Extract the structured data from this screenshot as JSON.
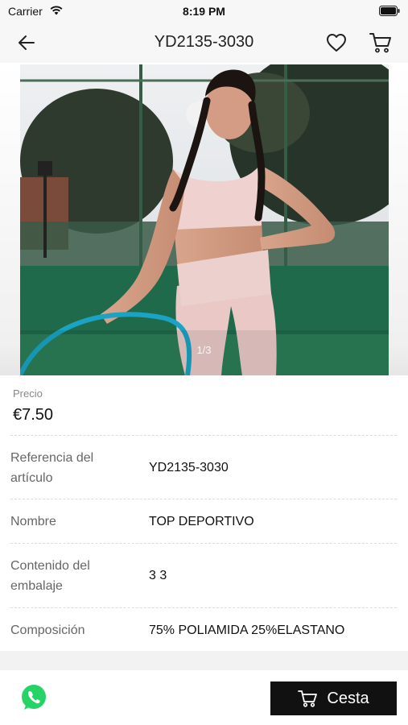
{
  "status_bar": {
    "carrier": "Carrier",
    "time": "8:19 PM"
  },
  "header": {
    "title": "YD2135-3030"
  },
  "gallery": {
    "indicator": "1/3"
  },
  "price": {
    "label": "Precio",
    "value": "€7.50"
  },
  "details": [
    {
      "label_lines": [
        "Referencia del",
        "artículo"
      ],
      "value": "YD2135-3030"
    },
    {
      "label_lines": [
        "Nombre"
      ],
      "value": "TOP DEPORTIVO"
    },
    {
      "label_lines": [
        "Contenido del",
        "embalaje"
      ],
      "value": "3 3"
    },
    {
      "label_lines": [
        "Composición"
      ],
      "value": "75% POLIAMIDA 25%ELASTANO"
    }
  ],
  "bottom": {
    "basket_label": "Cesta"
  },
  "colors": {
    "whatsapp": "#25d366",
    "button_bg": "#111111"
  }
}
